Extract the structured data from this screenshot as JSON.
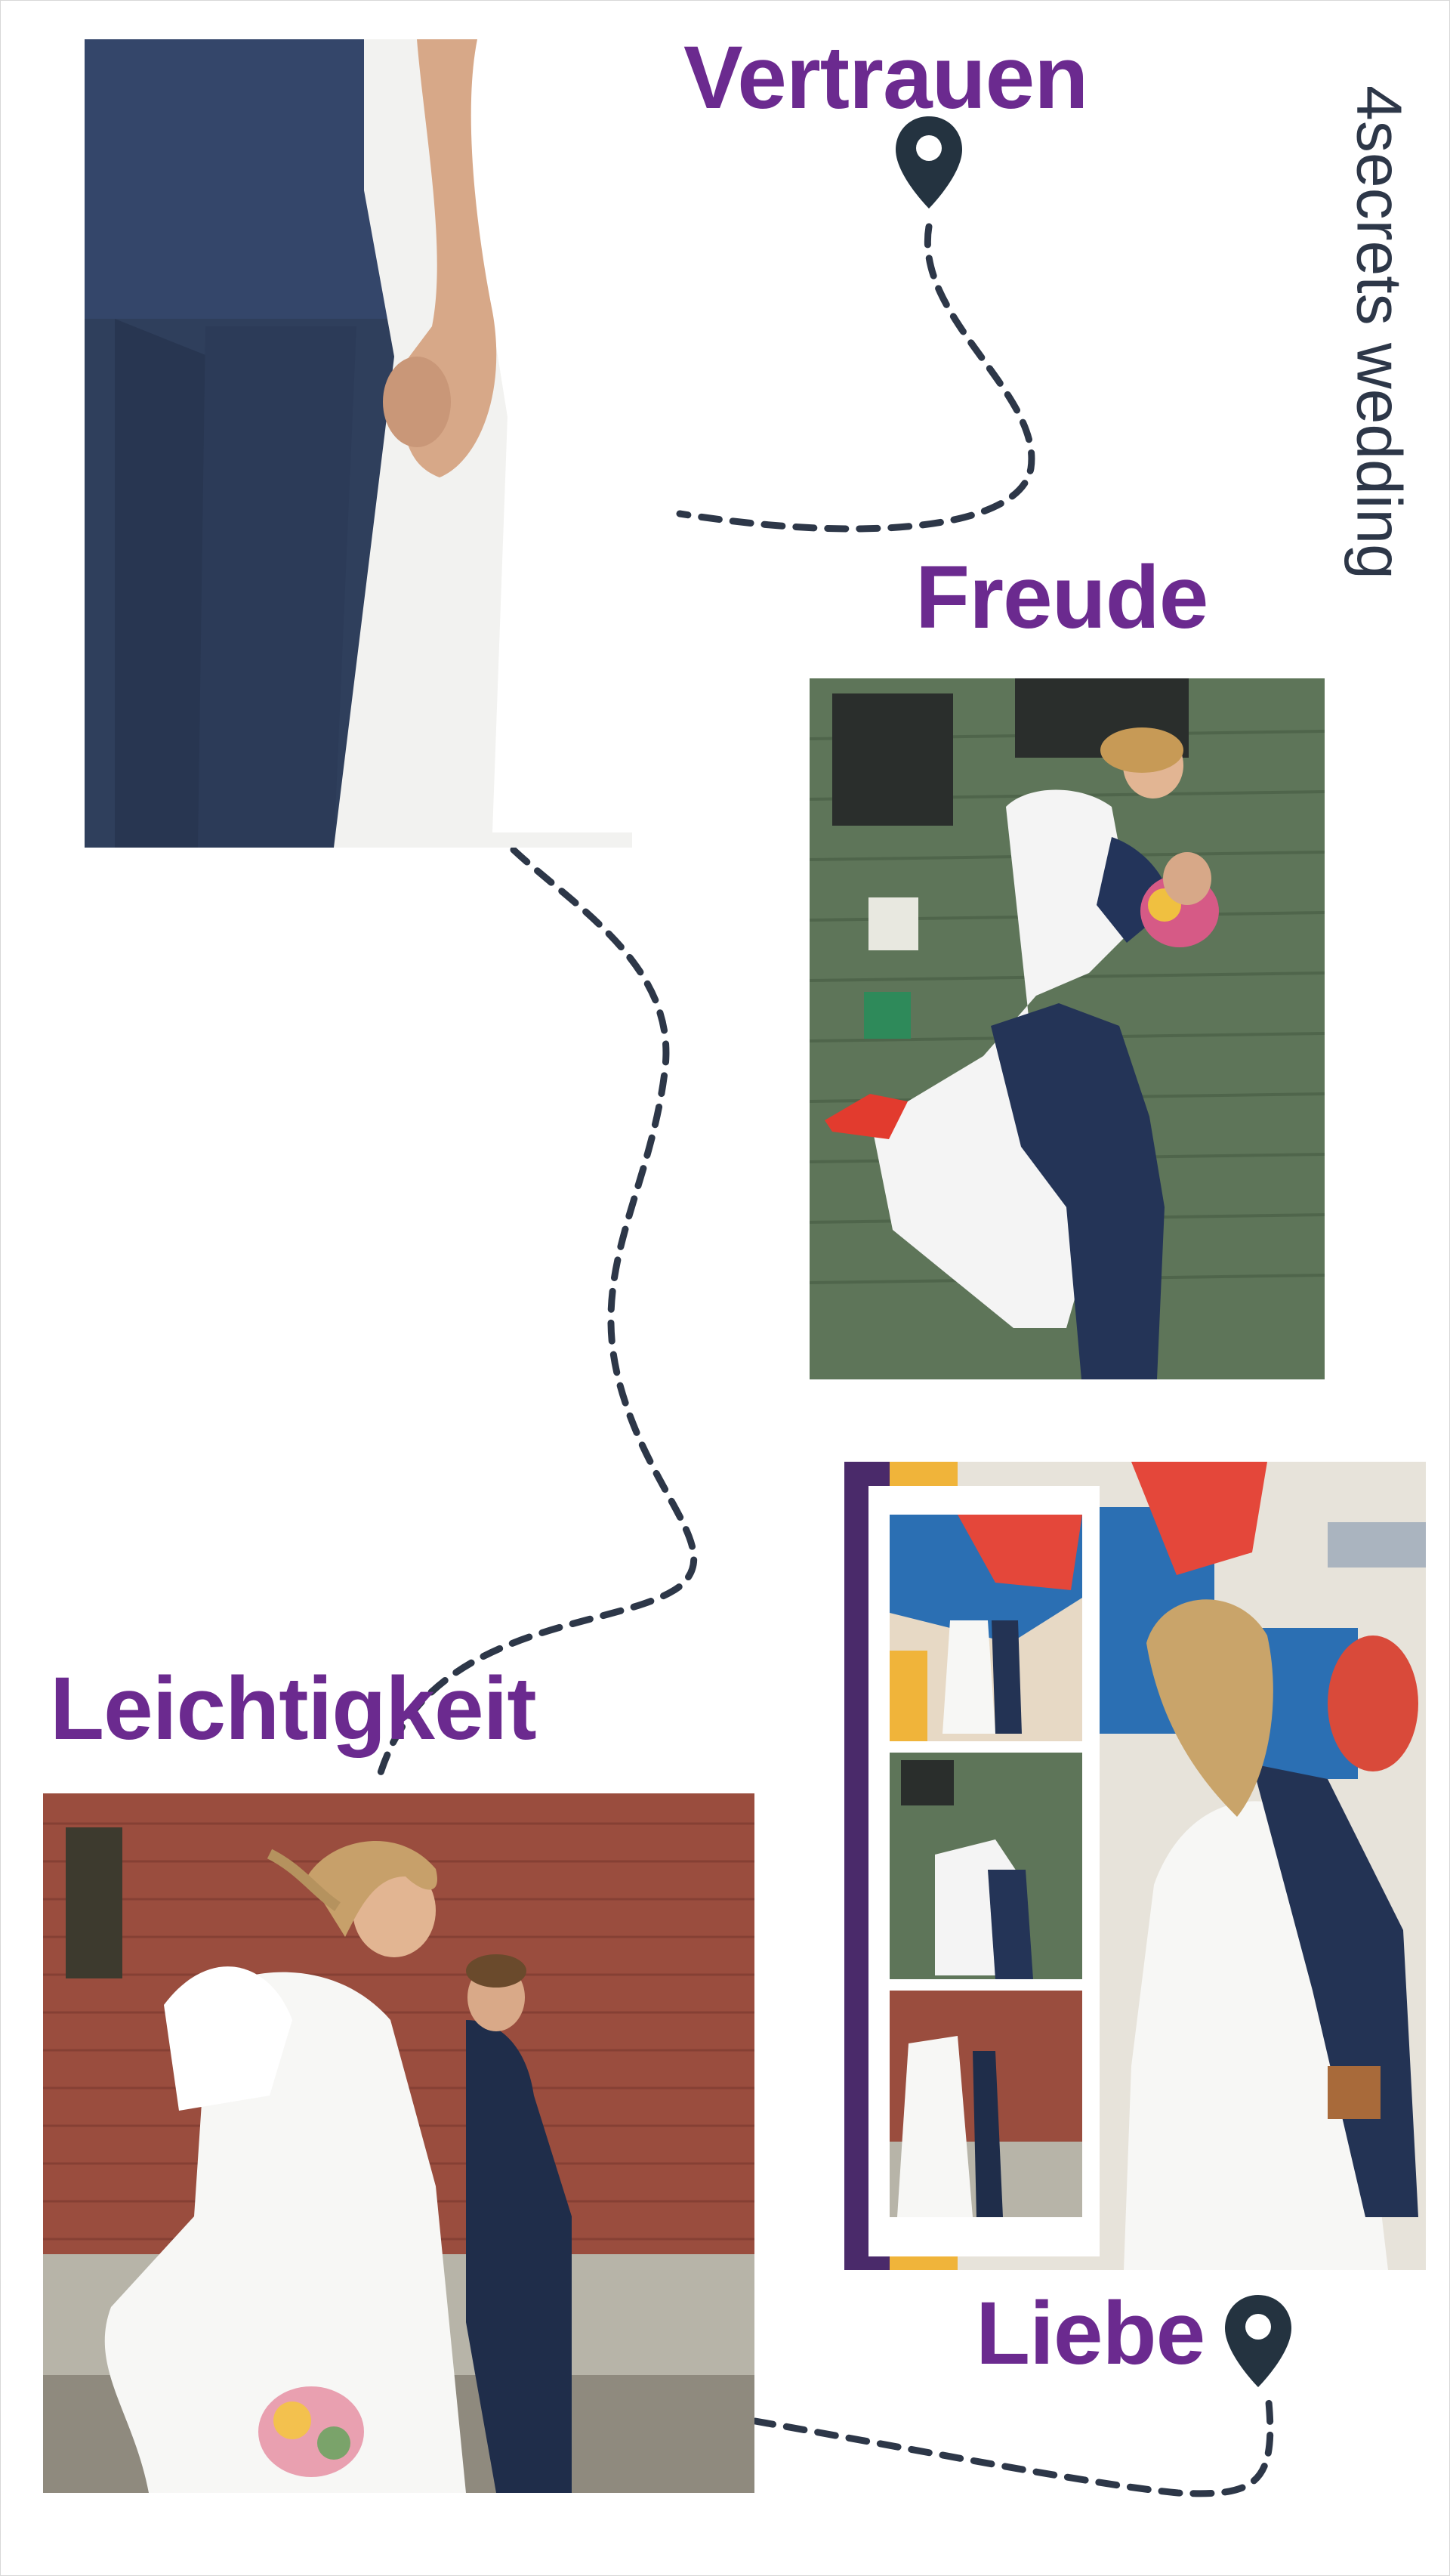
{
  "words": {
    "w1": "Vertrauen",
    "w2": "Freude",
    "w3": "Leichtigkeit",
    "w4": "Liebe"
  },
  "brand": "4secrets wedding",
  "icons": {
    "pin_top": "location-pin-icon",
    "pin_bottom": "location-pin-icon"
  },
  "colors": {
    "heading": "#6b2a8f",
    "path": "#2d3748",
    "pin": "#243340"
  }
}
